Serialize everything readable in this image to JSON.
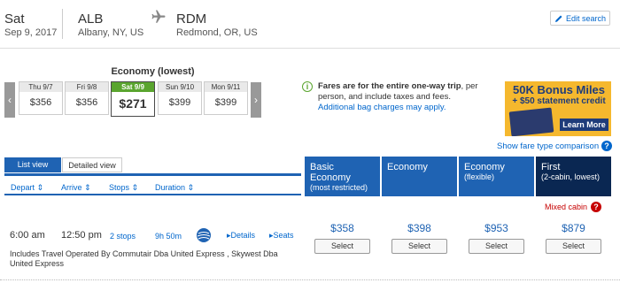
{
  "header": {
    "day": "Sat",
    "date": "Sep 9, 2017",
    "origin_code": "ALB",
    "origin_city": "Albany, NY, US",
    "dest_code": "RDM",
    "dest_city": "Redmond, OR, US",
    "edit_label": "Edit search"
  },
  "calendar": {
    "title": "Economy (lowest)",
    "days": [
      {
        "label": "Thu 9/7",
        "price": "$356"
      },
      {
        "label": "Fri 9/8",
        "price": "$356"
      },
      {
        "label": "Sat 9/9",
        "price": "$271"
      },
      {
        "label": "Sun 9/10",
        "price": "$399"
      },
      {
        "label": "Mon 9/11",
        "price": "$399"
      }
    ]
  },
  "note": {
    "bold": "Fares are for the entire one-way trip",
    "rest": ", per person, and include taxes and fees.",
    "link": "Additional bag charges may apply."
  },
  "ad": {
    "line1": "50K Bonus Miles",
    "line2": "+ $50 statement credit",
    "button": "Learn More"
  },
  "compare_link": "Show fare type comparison",
  "tabs": {
    "list": "List view",
    "detail": "Detailed view"
  },
  "sort": {
    "depart": "Depart",
    "arrive": "Arrive",
    "stops": "Stops",
    "duration": "Duration"
  },
  "columns": [
    {
      "t1": "Basic Economy",
      "t2": "(most restricted)"
    },
    {
      "t1": "Economy",
      "t2": ""
    },
    {
      "t1": "Economy",
      "t2": "(flexible)"
    },
    {
      "t1": "First",
      "t2": "(2-cabin, lowest)"
    }
  ],
  "mixed_cabin": "Mixed cabin",
  "flight": {
    "depart": "6:00 am",
    "arrive": "12:50 pm",
    "stops": "2 stops",
    "duration": "9h 50m",
    "details": "Details",
    "seats": "Seats",
    "operated": "Includes Travel Operated By Commutair Dba United Express , Skywest Dba United Express",
    "prices": [
      "$358",
      "$398",
      "$953",
      "$879"
    ],
    "select_label": "Select"
  }
}
